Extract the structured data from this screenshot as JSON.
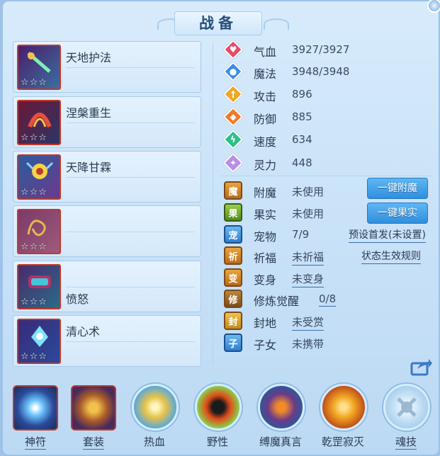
{
  "header": {
    "title": "战备"
  },
  "skills": [
    {
      "name": "天地护法",
      "stars": "☆☆☆"
    },
    {
      "name": "涅槃重生",
      "stars": "☆☆☆"
    },
    {
      "name": "天降甘霖",
      "stars": "☆☆☆"
    },
    {
      "name": "",
      "stars": "☆☆☆"
    },
    {
      "name": "愤怒",
      "stars": "☆☆☆"
    },
    {
      "name": "清心术",
      "stars": "☆☆☆"
    }
  ],
  "stats": [
    {
      "label": "气血",
      "value": "3927/3927",
      "color": "#e84a6a",
      "icon": "heart-icon"
    },
    {
      "label": "魔法",
      "value": "3948/3948",
      "color": "#3c8fe6",
      "icon": "drop-icon"
    },
    {
      "label": "攻击",
      "value": "896",
      "color": "#f2a623",
      "icon": "sword-icon"
    },
    {
      "label": "防御",
      "value": "885",
      "color": "#f07a2a",
      "icon": "shield-icon"
    },
    {
      "label": "速度",
      "value": "634",
      "color": "#2cbf8a",
      "icon": "lightning-icon"
    },
    {
      "label": "灵力",
      "value": "448",
      "color": "#b98ee6",
      "icon": "sparkle-icon"
    }
  ],
  "status": [
    {
      "label": "附魔",
      "value": "未使用",
      "glyph": "魔"
    },
    {
      "label": "果实",
      "value": "未使用",
      "glyph": "果"
    },
    {
      "label": "宠物",
      "value": "7/9",
      "glyph": "宠"
    },
    {
      "label": "祈福",
      "value": "未祈福",
      "glyph": "祈"
    },
    {
      "label": "变身",
      "value": "未变身",
      "glyph": "变"
    },
    {
      "label": "修炼觉醒",
      "value": "0/8",
      "glyph": "修"
    },
    {
      "label": "封地",
      "value": "未受赏",
      "glyph": "封"
    },
    {
      "label": "子女",
      "value": "未携带",
      "glyph": "子"
    }
  ],
  "actions": {
    "enchant_button": "一键附魔",
    "fruit_button": "一键果实",
    "preset_link": "预设首发(未设置)",
    "rules_link": "状态生效规则"
  },
  "bottom_bar": [
    {
      "label": "神符"
    },
    {
      "label": "套装"
    },
    {
      "label": "热血"
    },
    {
      "label": "野性"
    },
    {
      "label": "缚魔真言"
    },
    {
      "label": "乾罡寂灭"
    },
    {
      "label": "魂技"
    }
  ],
  "colors": {
    "accent_blue": "#2f8fde",
    "frame_red": "#c0392b",
    "panel_bg": "#d7ebfb"
  }
}
